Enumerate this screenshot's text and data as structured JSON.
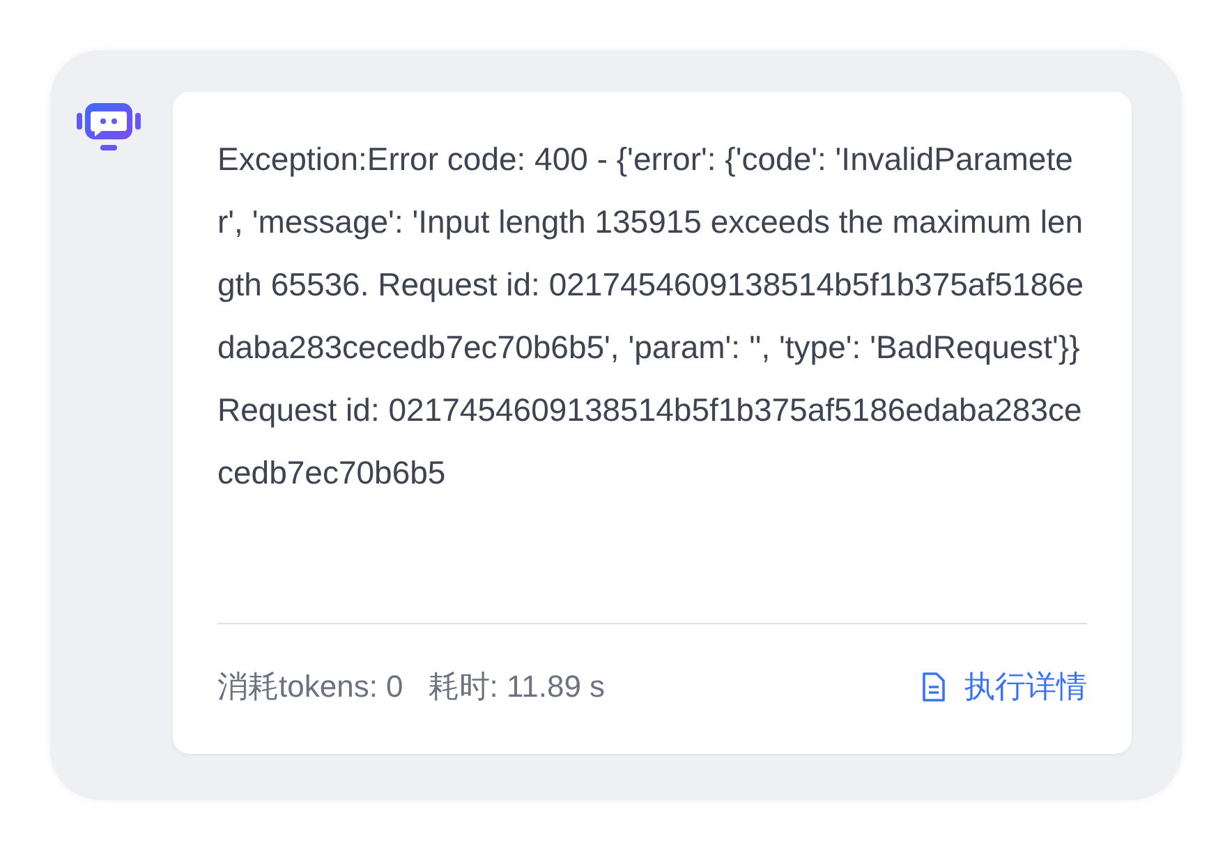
{
  "message": {
    "text": "Exception:Error code: 400 - {'error': {'code': 'InvalidParameter', 'message': 'Input length 135915 exceeds the maximum length 65536. Request id: 0217454609138514b5f1b375af5186edaba283cecedb7ec70b6b5', 'param': '', 'type': 'BadRequest'}} Request id: 0217454609138514b5f1b375af5186edaba283cecedb7ec70b6b5"
  },
  "footer": {
    "tokens": "消耗tokens: 0",
    "elapsed": "耗时: 11.89 s",
    "details_link": "执行详情"
  }
}
